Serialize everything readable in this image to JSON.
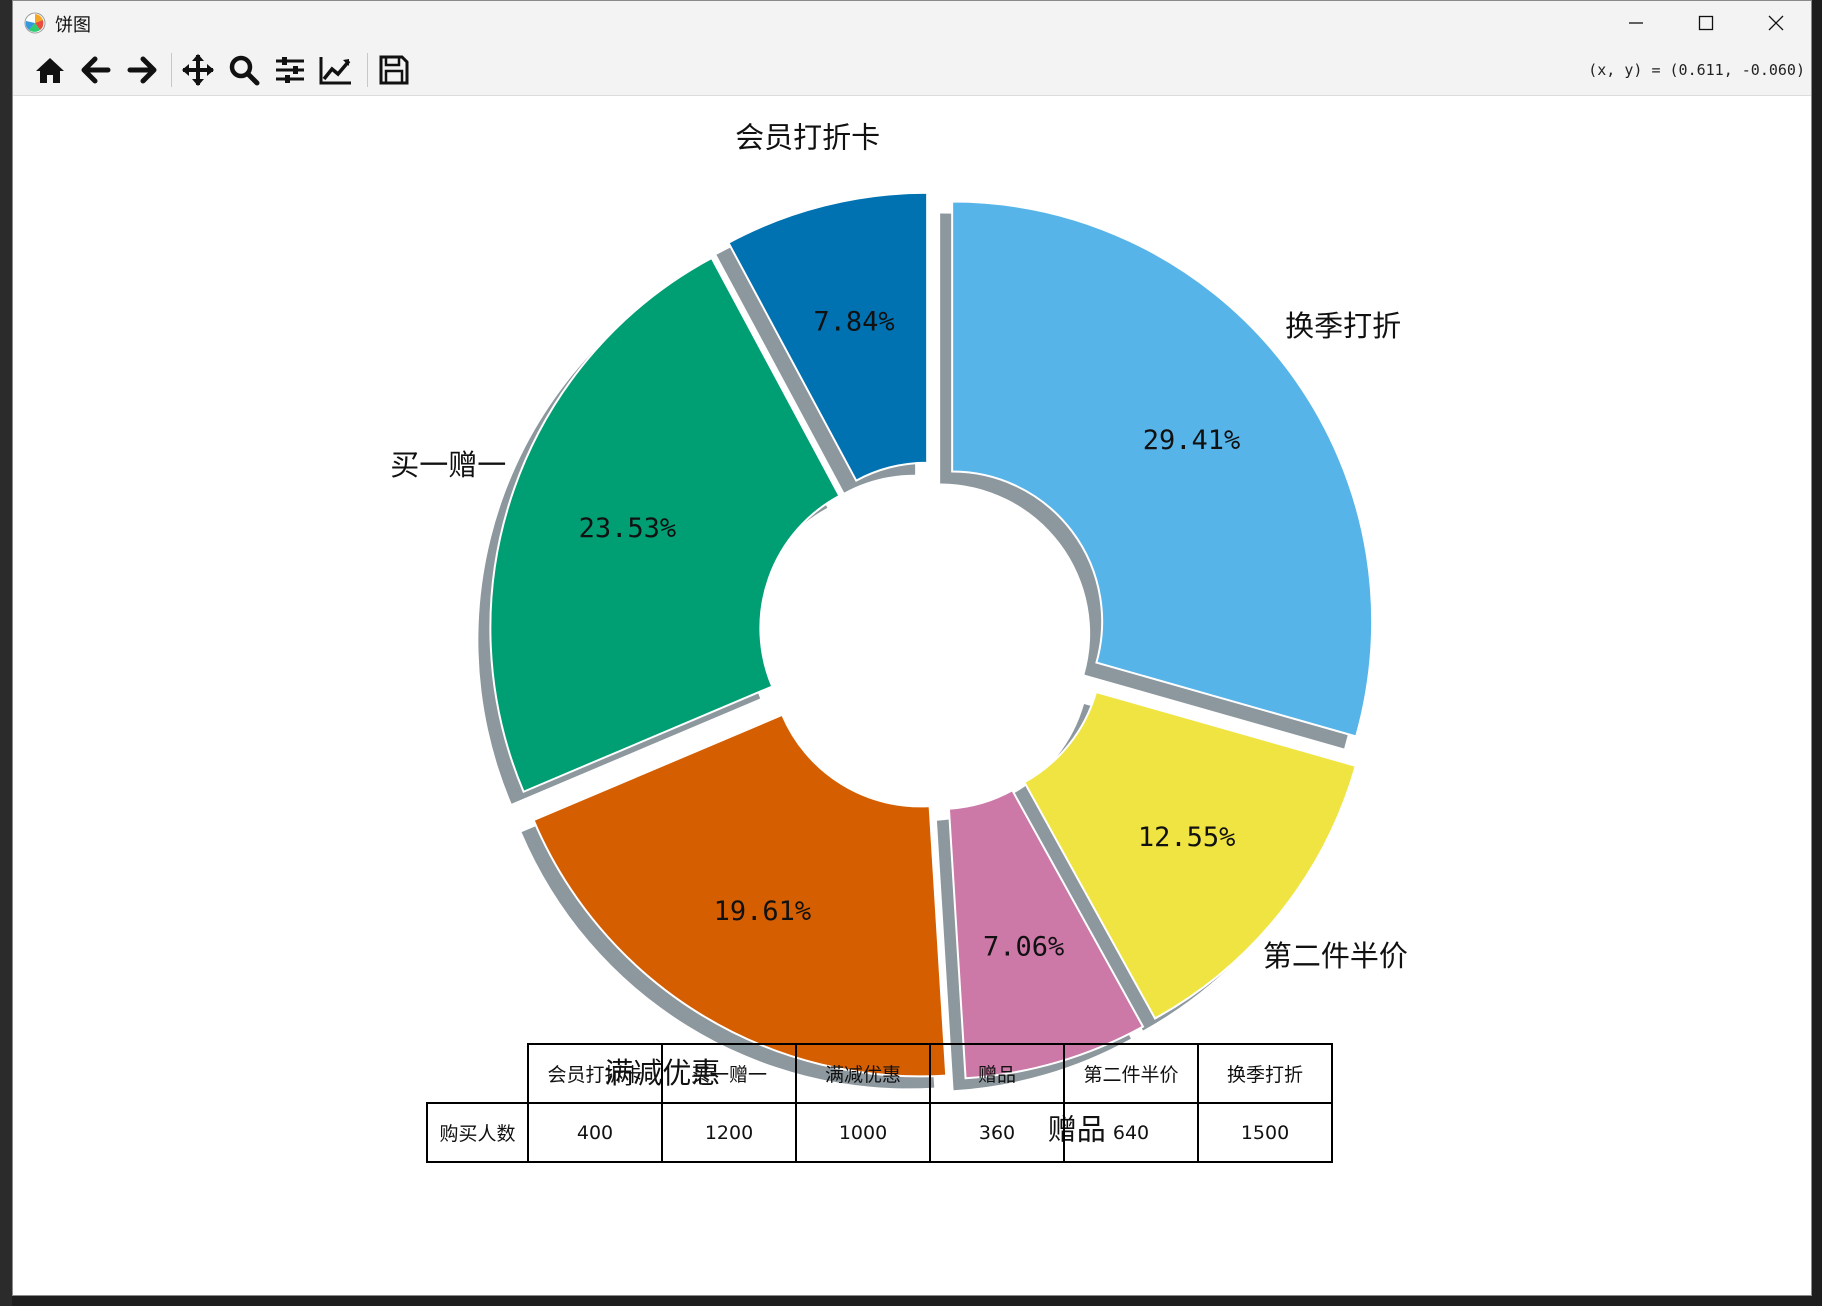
{
  "window": {
    "title": "饼图"
  },
  "toolbar": {
    "tools": [
      {
        "name": "home-icon"
      },
      {
        "name": "back-icon"
      },
      {
        "name": "forward-icon"
      },
      {
        "name": "pan-icon"
      },
      {
        "name": "zoom-icon"
      },
      {
        "name": "configure-subplots-icon"
      },
      {
        "name": "edit-axis-icon"
      },
      {
        "name": "save-icon"
      }
    ],
    "coordinates": "(x, y) = (0.611, -0.060)"
  },
  "colors": {
    "accent": "#0072b2"
  },
  "chart_data": {
    "type": "pie",
    "categories": [
      "会员打折卡",
      "买一赠一",
      "满减优惠",
      "赠品",
      "第二件半价",
      "换季打折"
    ],
    "values": [
      400,
      1200,
      1000,
      360,
      640,
      1500
    ],
    "percent_labels": [
      "7.84%",
      "23.53%",
      "19.61%",
      "7.06%",
      "12.55%",
      "29.41%"
    ],
    "colors": [
      "#0072b2",
      "#009e73",
      "#d55e00",
      "#cc79a7",
      "#f0e442",
      "#56b4e9"
    ],
    "donut": true,
    "shadow": true,
    "exploded": true,
    "table": {
      "columns": [
        "会员打折卡",
        "买一赠一",
        "满减优惠",
        "赠品",
        "第二件半价",
        "换季打折"
      ],
      "row_label": "购买人数",
      "row_values": [
        "400",
        "1200",
        "1000",
        "360",
        "640",
        "1500"
      ]
    }
  }
}
